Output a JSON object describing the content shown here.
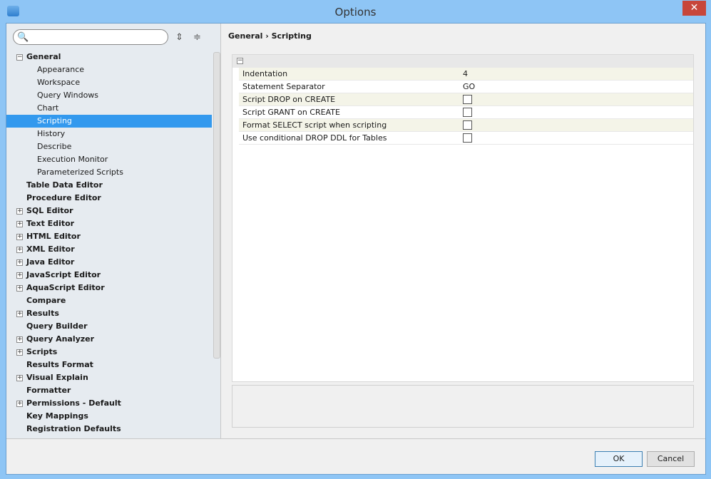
{
  "window": {
    "title": "Options",
    "close": "✕"
  },
  "toolbar": {
    "expand_all": "⇕",
    "collapse_all": "≑",
    "search_icon": "🔍"
  },
  "breadcrumb": "General › Scripting",
  "tree": [
    {
      "label": "General",
      "level": 0,
      "exp": "−"
    },
    {
      "label": "Appearance",
      "level": 1
    },
    {
      "label": "Workspace",
      "level": 1
    },
    {
      "label": "Query Windows",
      "level": 1
    },
    {
      "label": "Chart",
      "level": 1
    },
    {
      "label": "Scripting",
      "level": 1,
      "selected": true
    },
    {
      "label": "History",
      "level": 1
    },
    {
      "label": "Describe",
      "level": 1
    },
    {
      "label": "Execution Monitor",
      "level": 1
    },
    {
      "label": "Parameterized Scripts",
      "level": 1
    },
    {
      "label": "Table Data Editor",
      "level": 0
    },
    {
      "label": "Procedure Editor",
      "level": 0
    },
    {
      "label": "SQL Editor",
      "level": 0,
      "exp": "+"
    },
    {
      "label": "Text Editor",
      "level": 0,
      "exp": "+"
    },
    {
      "label": "HTML Editor",
      "level": 0,
      "exp": "+"
    },
    {
      "label": "XML Editor",
      "level": 0,
      "exp": "+"
    },
    {
      "label": "Java Editor",
      "level": 0,
      "exp": "+"
    },
    {
      "label": "JavaScript Editor",
      "level": 0,
      "exp": "+"
    },
    {
      "label": "AquaScript Editor",
      "level": 0,
      "exp": "+"
    },
    {
      "label": "Compare",
      "level": 0
    },
    {
      "label": "Results",
      "level": 0,
      "exp": "+"
    },
    {
      "label": "Query Builder",
      "level": 0
    },
    {
      "label": "Query Analyzer",
      "level": 0,
      "exp": "+"
    },
    {
      "label": "Scripts",
      "level": 0,
      "exp": "+"
    },
    {
      "label": "Results Format",
      "level": 0
    },
    {
      "label": "Visual Explain",
      "level": 0,
      "exp": "+"
    },
    {
      "label": "Formatter",
      "level": 0
    },
    {
      "label": "Permissions - Default",
      "level": 0,
      "exp": "+"
    },
    {
      "label": "Key Mappings",
      "level": 0
    },
    {
      "label": "Registration Defaults",
      "level": 0
    }
  ],
  "grid": {
    "group_toggle": "−",
    "properties": [
      {
        "label": "Indentation",
        "value": "4"
      },
      {
        "label": "Statement Separator",
        "value": "GO"
      },
      {
        "label": "Script DROP on CREATE",
        "checked": false
      },
      {
        "label": "Script GRANT on CREATE",
        "checked": false
      },
      {
        "label": "Format SELECT script when scripting",
        "checked": false
      },
      {
        "label": "Use conditional DROP DDL for Tables",
        "checked": false
      }
    ]
  },
  "buttons": {
    "ok": "OK",
    "cancel": "Cancel"
  }
}
